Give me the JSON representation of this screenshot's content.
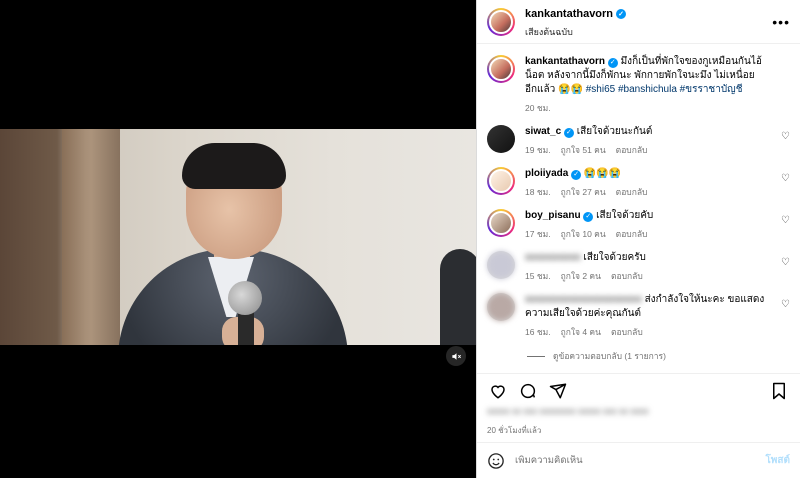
{
  "post": {
    "username": "kankantathavorn",
    "subtitle": "เสียงต้นฉบับ",
    "caption_user": "kankantathavorn",
    "caption_text": "มึงก็เป็นที่พักใจของกูเหมือนกันไอ้น็อต หลังจากนี้มึงก็พักนะ พักกายพักใจนะมึง ไม่เหนื่อยอีกแล้ว 😭😭",
    "caption_tags": "#shi65 #banshichula #ขรราชาบัญชี",
    "caption_time": "20 ชม."
  },
  "comments": [
    {
      "user": "siwat_c",
      "verified": true,
      "text": "เสียใจด้วยนะกันต์",
      "time": "19 ชม.",
      "likes": "ถูกใจ 51 คน",
      "reply": "ตอบกลับ",
      "blurred": false
    },
    {
      "user": "ploiiyada",
      "verified": true,
      "text": "😭😭😭",
      "time": "18 ชม.",
      "likes": "ถูกใจ 27 คน",
      "reply": "ตอบกลับ",
      "blurred": false
    },
    {
      "user": "boy_pisanu",
      "verified": true,
      "text": "เสียใจด้วยคับ",
      "time": "17 ชม.",
      "likes": "ถูกใจ 10 คน",
      "reply": "ตอบกลับ",
      "blurred": false
    },
    {
      "user": "xxxxxxxxxx",
      "verified": false,
      "text": "เสียใจด้วยครับ",
      "time": "15 ชม.",
      "likes": "ถูกใจ 2 คน",
      "reply": "ตอบกลับ",
      "blurred": true
    },
    {
      "user": "xxxxxxxxxxxxxxxxxxxxx",
      "verified": false,
      "text": "ส่งกำลังใจให้นะคะ ขอแสดงความเสียใจด้วยค่ะคุณกันต์",
      "time": "16 ชม.",
      "likes": "ถูกใจ 4 คน",
      "reply": "ตอบกลับ",
      "blurred": true
    }
  ],
  "more_replies": "ดูข้อความตอบกลับ (1 รายการ)",
  "likes_text": "xxxxx xx xxx xxxxxxxx xxxxx xxx xx xxxx",
  "posted_time": "20 ชั่วโมงที่แล้ว",
  "add_comment": {
    "placeholder": "เพิ่มความคิดเห็น",
    "post_label": "โพสต์"
  },
  "colors": {
    "accent": "#0095f6",
    "hashtag": "#00376b",
    "muted": "#737373"
  },
  "icons": [
    "more-icon",
    "mute-icon",
    "heart-icon",
    "comment-icon",
    "share-icon",
    "bookmark-icon",
    "emoji-icon",
    "verified-icon"
  ]
}
